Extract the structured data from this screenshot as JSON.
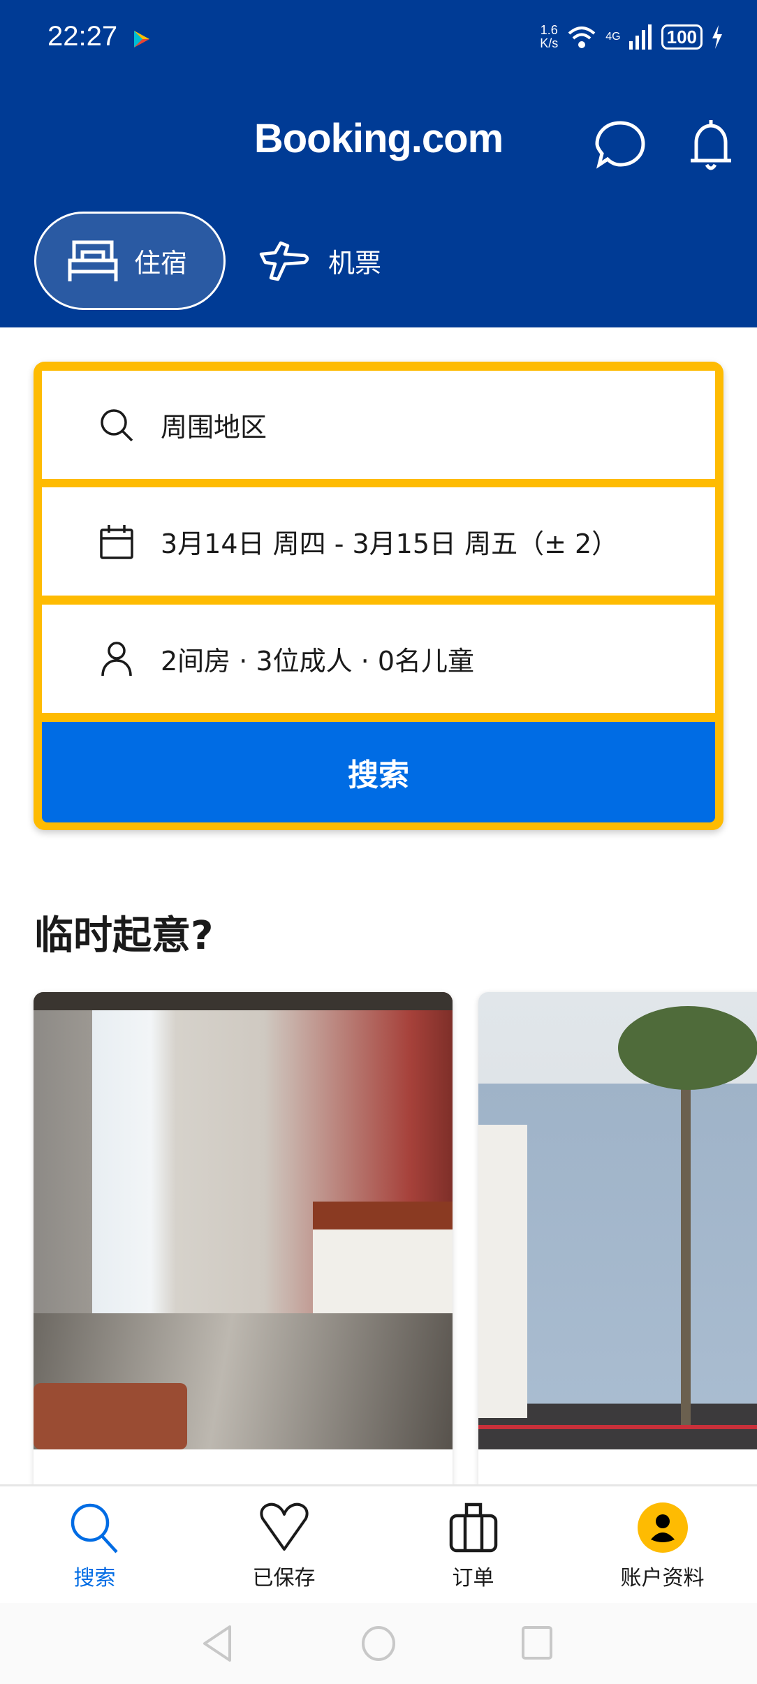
{
  "status_bar": {
    "time": "22:27",
    "speed_value": "1.6",
    "speed_unit": "K/s",
    "network": "4G",
    "battery": "100"
  },
  "header": {
    "logo": "Booking.com",
    "tabs": [
      {
        "label": "住宿",
        "icon": "bed-icon",
        "active": true
      },
      {
        "label": "机票",
        "icon": "plane-icon",
        "active": false
      }
    ]
  },
  "search": {
    "destination": "周围地区",
    "dates": "3月14日 周四 - 3月15日 周五（± 2）",
    "guests": "2间房 · 3位成人 · 0名儿童",
    "button": "搜索"
  },
  "colors": {
    "brand": "#003b95",
    "accent": "#febb02",
    "button": "#006ce4"
  },
  "section": {
    "title": "临时起意?"
  },
  "bottom_nav": [
    {
      "label": "搜索",
      "icon": "search-icon",
      "active": true
    },
    {
      "label": "已保存",
      "icon": "heart-icon"
    },
    {
      "label": "订单",
      "icon": "suitcase-icon"
    },
    {
      "label": "账户资料",
      "icon": "account-icon"
    }
  ]
}
